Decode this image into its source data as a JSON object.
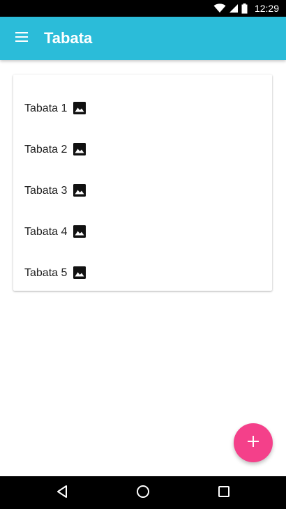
{
  "status_bar": {
    "time": "12:29",
    "icons": [
      "wifi-icon",
      "signal-icon",
      "battery-icon"
    ]
  },
  "app_bar": {
    "title": "Tabata",
    "menu_icon": "menu-icon",
    "color": "#2bbcd9"
  },
  "list": {
    "items": [
      {
        "label": "Tabata 1",
        "icon": "image-icon"
      },
      {
        "label": "Tabata 2",
        "icon": "image-icon"
      },
      {
        "label": "Tabata 3",
        "icon": "image-icon"
      },
      {
        "label": "Tabata 4",
        "icon": "image-icon"
      },
      {
        "label": "Tabata 5",
        "icon": "image-icon"
      }
    ]
  },
  "fab": {
    "icon": "plus-icon",
    "color": "#f4408a"
  },
  "nav_bar": {
    "icons": [
      "back-icon",
      "home-icon",
      "recents-icon"
    ]
  }
}
